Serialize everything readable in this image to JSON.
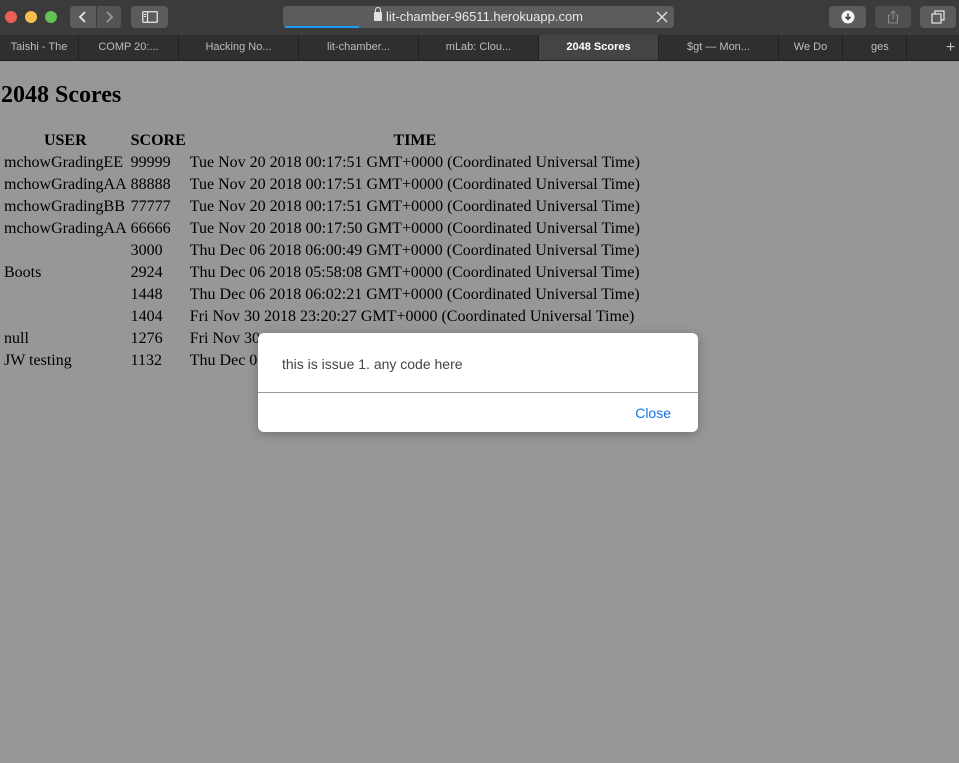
{
  "browser": {
    "url": "lit-chamber-96511.herokuapp.com",
    "page_load_progress": 0.19,
    "tabs": [
      {
        "label": "Taishi - The"
      },
      {
        "label": "COMP 20:..."
      },
      {
        "label": "Hacking No..."
      },
      {
        "label": "lit-chamber..."
      },
      {
        "label": "mLab: Clou..."
      },
      {
        "label": "2048 Scores",
        "active": true
      },
      {
        "label": "$gt — Mon..."
      },
      {
        "label": "We Do"
      },
      {
        "label": "ges"
      }
    ],
    "icons": {
      "back": "chevron-left-icon",
      "forward": "chevron-right-icon",
      "sidebar": "sidebar-icon",
      "lock": "lock-icon",
      "stop": "close-icon",
      "download": "download-icon",
      "share": "share-icon",
      "tabs": "tab-overview-icon",
      "new_tab": "plus-icon"
    }
  },
  "page": {
    "title": "2048 Scores",
    "columns": [
      "USER",
      "SCORE",
      "TIME"
    ],
    "rows": [
      {
        "user": "mchowGradingEE",
        "score": "99999",
        "time": "Tue Nov 20 2018 00:17:51 GMT+0000 (Coordinated Universal Time)"
      },
      {
        "user": "mchowGradingAA",
        "score": "88888",
        "time": "Tue Nov 20 2018 00:17:51 GMT+0000 (Coordinated Universal Time)"
      },
      {
        "user": "mchowGradingBB",
        "score": "77777",
        "time": "Tue Nov 20 2018 00:17:51 GMT+0000 (Coordinated Universal Time)"
      },
      {
        "user": "mchowGradingAA",
        "score": "66666",
        "time": "Tue Nov 20 2018 00:17:50 GMT+0000 (Coordinated Universal Time)"
      },
      {
        "user": "",
        "score": "3000",
        "time": "Thu Dec 06 2018 06:00:49 GMT+0000 (Coordinated Universal Time)"
      },
      {
        "user": "Boots",
        "score": "2924",
        "time": "Thu Dec 06 2018 05:58:08 GMT+0000 (Coordinated Universal Time)"
      },
      {
        "user": "",
        "score": "1448",
        "time": "Thu Dec 06 2018 06:02:21 GMT+0000 (Coordinated Universal Time)"
      },
      {
        "user": "",
        "score": "1404",
        "time": "Fri Nov 30 2018 23:20:27 GMT+0000 (Coordinated Universal Time)"
      },
      {
        "user": "null",
        "score": "1276",
        "time": "Fri Nov 30"
      },
      {
        "user": "JW testing",
        "score": "1132",
        "time": "Thu Dec 06"
      }
    ]
  },
  "modal": {
    "message": "this is issue 1. any code here",
    "close_label": "Close"
  },
  "colors": {
    "overlay_background": "#979797",
    "link_blue": "#1473e6",
    "progress_blue": "#1a9cf3",
    "toolbar": "#3b3b3b"
  }
}
